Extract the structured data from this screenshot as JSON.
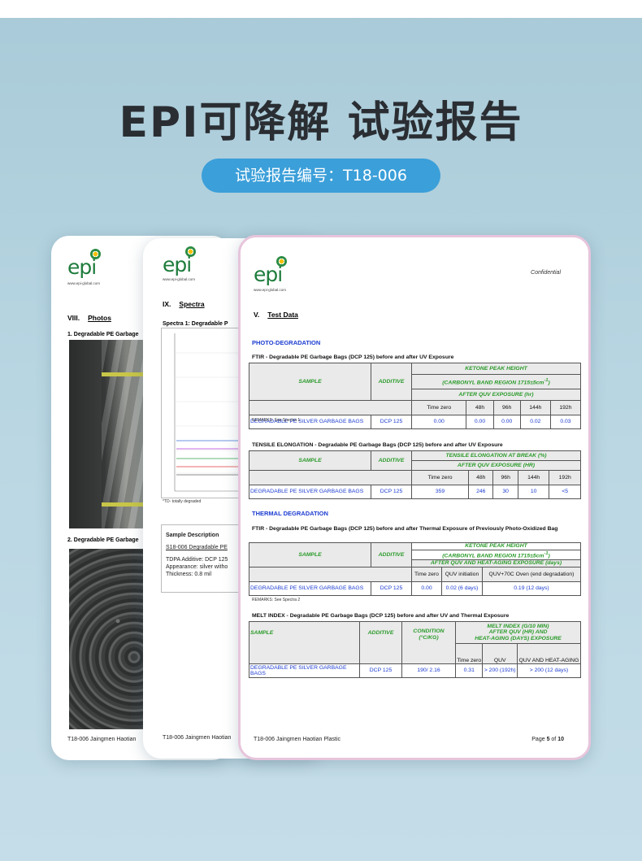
{
  "header": {
    "title": "EPI可降解 试验报告",
    "report_no": "试验报告编号：T18-006"
  },
  "colors": {
    "accent": "#3b9fd9",
    "green": "#2a9a2a",
    "blue": "#1b3bd0"
  },
  "logo": {
    "text": "epi",
    "url": "www.epi-global.com"
  },
  "page1": {
    "section_num": "VIII.",
    "section": "Photos",
    "cap1": "1. Degradable PE Garbage",
    "cap2": "2. Degradable PE Garbage",
    "footer": "T18-006 Jaingmen Haotian"
  },
  "page2": {
    "section_num": "IX.",
    "section": "Spectra",
    "chart_title": "Spectra 1: Degradable P",
    "chart_note": "*TD- totally degraded",
    "desc_title": "Sample Description",
    "desc_link": "S18-006 Degradable PE",
    "desc_l1": "TDPA Additive: DCP 125",
    "desc_l2": "Appearance: silver witho",
    "desc_l3": "Thickness: 0.8 mil",
    "footer": "T18-006 Jaingmen Haotian"
  },
  "page3": {
    "confidential": "Confidential",
    "section_num": "V.",
    "section": "Test Data",
    "photo_heading": "PHOTO-DEGRADATION",
    "t1": {
      "caption": "FTIR - Degradable PE Garbage Bags (DCP 125) before and after UV Exposure",
      "sample": "SAMPLE",
      "additive": "ADDITIVE",
      "h1": "KETONE PEAK HEIGHT",
      "h2": "(CARBONYL BAND REGION 1715±5cm",
      "h2sup": "-1",
      "h2end": ")",
      "h3": "AFTER QUV EXPOSURE (hr)",
      "cols": [
        "Time zero",
        "48h",
        "96h",
        "144h",
        "192h"
      ],
      "row": {
        "sample": "DEGRADABLE PE SILVER GARBAGE BAGS",
        "additive": "DCP 125",
        "vals": [
          "0.00",
          "0.00",
          "0.00",
          "0.02",
          "0.03"
        ]
      },
      "remarks": "REMARKS: See Spectra 1"
    },
    "t2": {
      "caption": "TENSILE ELONGATION - Degradable PE Garbage Bags (DCP 125) before and after UV Exposure",
      "sample": "SAMPLE",
      "additive": "ADDITIVE",
      "h1": "TENSILE ELONGATION AT BREAK (%)",
      "h2": "AFTER QUV EXPOSURE (HR)",
      "cols": [
        "Time zero",
        "48h",
        "96h",
        "144h",
        "192h"
      ],
      "row": {
        "sample": "DEGRADABLE PE SILVER GARBAGE BAGS",
        "additive": "DCP 125",
        "vals": [
          "359",
          "246",
          "30",
          "10",
          "<5"
        ]
      }
    },
    "thermal_heading": "THERMAL DEGRADATION",
    "t3": {
      "caption": "FTIR - Degradable PE Garbage Bags (DCP 125) before and after Thermal Exposure of Previously Photo-Oxidized Bag",
      "sample": "SAMPLE",
      "additive": "ADDITIVE",
      "h1": "KETONE PEAK HEIGHT",
      "h2": "(CARBONYL BAND REGION 1715±5cm",
      "h2sup": "-1",
      "h2end": ")",
      "h3": "AFTER QUV AND  HEAT-AGING EXPOSURE (days)",
      "cols": [
        "Time zero",
        "QUV initiation",
        "QUV+70C Oven (end degradation)"
      ],
      "row": {
        "sample": "DEGRADABLE PE SILVER GARBAGE BAGS",
        "additive": "DCP 125",
        "vals": [
          "0.00",
          "0.02 (6 days)",
          "0.19 (12 days)"
        ]
      },
      "remarks": "REMARKS: See Spectra 2"
    },
    "t4": {
      "caption": "MELT INDEX - Degradable PE Garbage Bags (DCP 125) before and after UV and Thermal Exposure",
      "sample": "SAMPLE",
      "additive": "ADDITIVE",
      "condition": "CONDITION",
      "cond_unit": "(°C/KG)",
      "h1": "MELT INDEX (G/10 MIN)",
      "h2": "AFTER QUV (HR) AND",
      "h3": "HEAT-AGING (DAYS) EXPOSURE",
      "cols": [
        "Time zero",
        "QUV",
        "QUV AND HEAT-AGING"
      ],
      "row": {
        "sample": "DEGRADABLE PE SILVER GARBAGE BAGS",
        "additive": "DCP 125",
        "condition": "190/ 2.16",
        "vals": [
          "0.31",
          "> 200 (192h)",
          "> 200 (12 days)"
        ]
      }
    },
    "footer": "T18-006 Jaingmen Haotian Plastic",
    "page_pre": "Page ",
    "page_num": "5",
    "page_mid": " of ",
    "page_total": "10"
  }
}
